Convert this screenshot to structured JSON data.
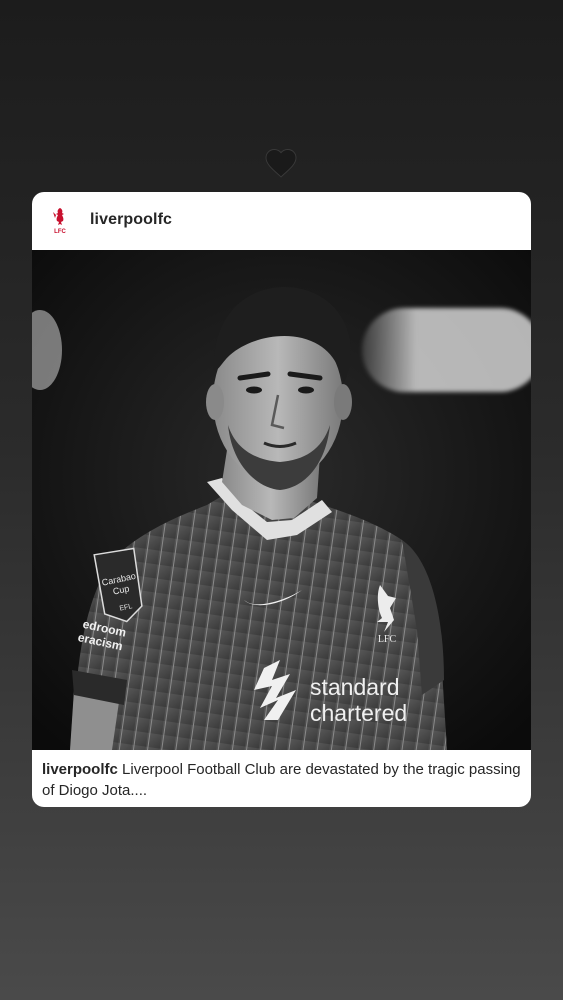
{
  "story": {
    "reaction_icon": "black-heart-icon",
    "background_colors": [
      "#1c1c1c",
      "#4a4a4a"
    ]
  },
  "post": {
    "username": "liverpoolfc",
    "avatar_icon": "lfc-crest-icon",
    "image_description_icon": "player-photo",
    "caption_username": "liverpoolfc",
    "caption_text": "Liverpool Football Club are devastated by the tragic passing of Diogo Jota....",
    "jersey_texts": {
      "sponsor_line1": "standard",
      "sponsor_line2": "chartered",
      "crest_text": "LFC",
      "badge_line1": "Carabao",
      "badge_line2": "Cup",
      "badge_efl": "EFL",
      "sleeve_line1": "edroom",
      "sleeve_line2": "eracism"
    },
    "brand_color": "#c8102e"
  }
}
